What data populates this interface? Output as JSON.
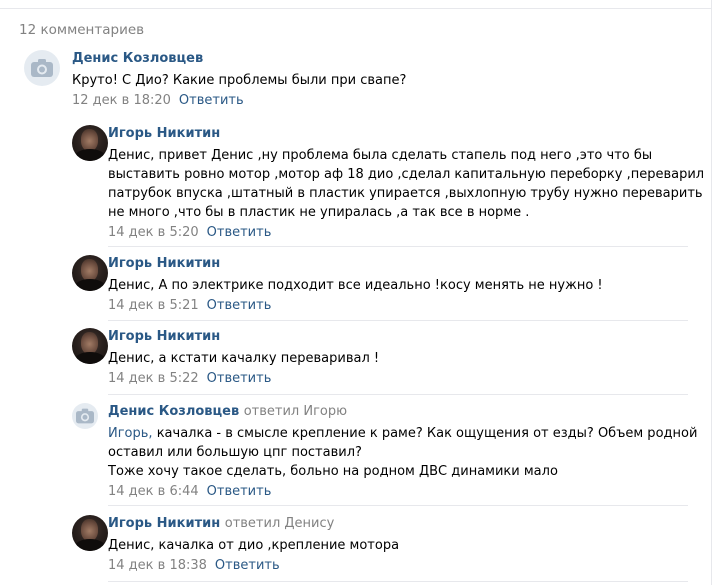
{
  "comments_count": "12 комментариев",
  "reply_label": "Ответить",
  "comments": [
    {
      "author": "Денис Козловцев",
      "reply_note": "",
      "addressee": "",
      "lines": [
        "Круто! С Дио? Какие проблемы были при свапе?"
      ],
      "time": "12 дек в 18:20",
      "avatar": "camera-icon"
    },
    {
      "author": "Игорь Никитин",
      "reply_note": "",
      "addressee": "",
      "lines": [
        "Денис, привет Денис ,ну проблема была сделать стапель под него ,это что бы",
        "выставить ровно мотор ,мотор аф 18 дио ,сделал капитальную переборку ,переварил",
        "патрубок впуска ,штатный в пластик упирается ,выхлопную трубу нужно переварить",
        "не много ,что бы в пластик не упиралась ,а так все в норме ."
      ],
      "time": "14 дек в 5:20",
      "avatar": "photo"
    },
    {
      "author": "Игорь Никитин",
      "reply_note": "",
      "addressee": "",
      "lines": [
        "Денис, А по электрике подходит все идеально !косу менять не нужно !"
      ],
      "time": "14 дек в 5:21",
      "avatar": "photo"
    },
    {
      "author": "Игорь Никитин",
      "reply_note": "",
      "addressee": "",
      "lines": [
        "Денис, а кстати качалку переваривал !"
      ],
      "time": "14 дек в 5:22",
      "avatar": "photo"
    },
    {
      "author": "Денис Козловцев",
      "reply_note": "ответил Игорю",
      "addressee": "Игорь,",
      "lines": [
        " качалка - в смысле крепление к раме? Как ощущения от езды? Объем родной",
        "оставил или большую цпг поставил?",
        "Тоже хочу такое сделать, больно на родном ДВС динамики мало"
      ],
      "time": "14 дек в 6:44",
      "avatar": "camera-icon"
    },
    {
      "author": "Игорь Никитин",
      "reply_note": "ответил Денису",
      "addressee": "",
      "lines": [
        "Денис, качалка от дио ,крепление мотора"
      ],
      "time": "14 дек в 18:38",
      "avatar": "photo"
    }
  ]
}
